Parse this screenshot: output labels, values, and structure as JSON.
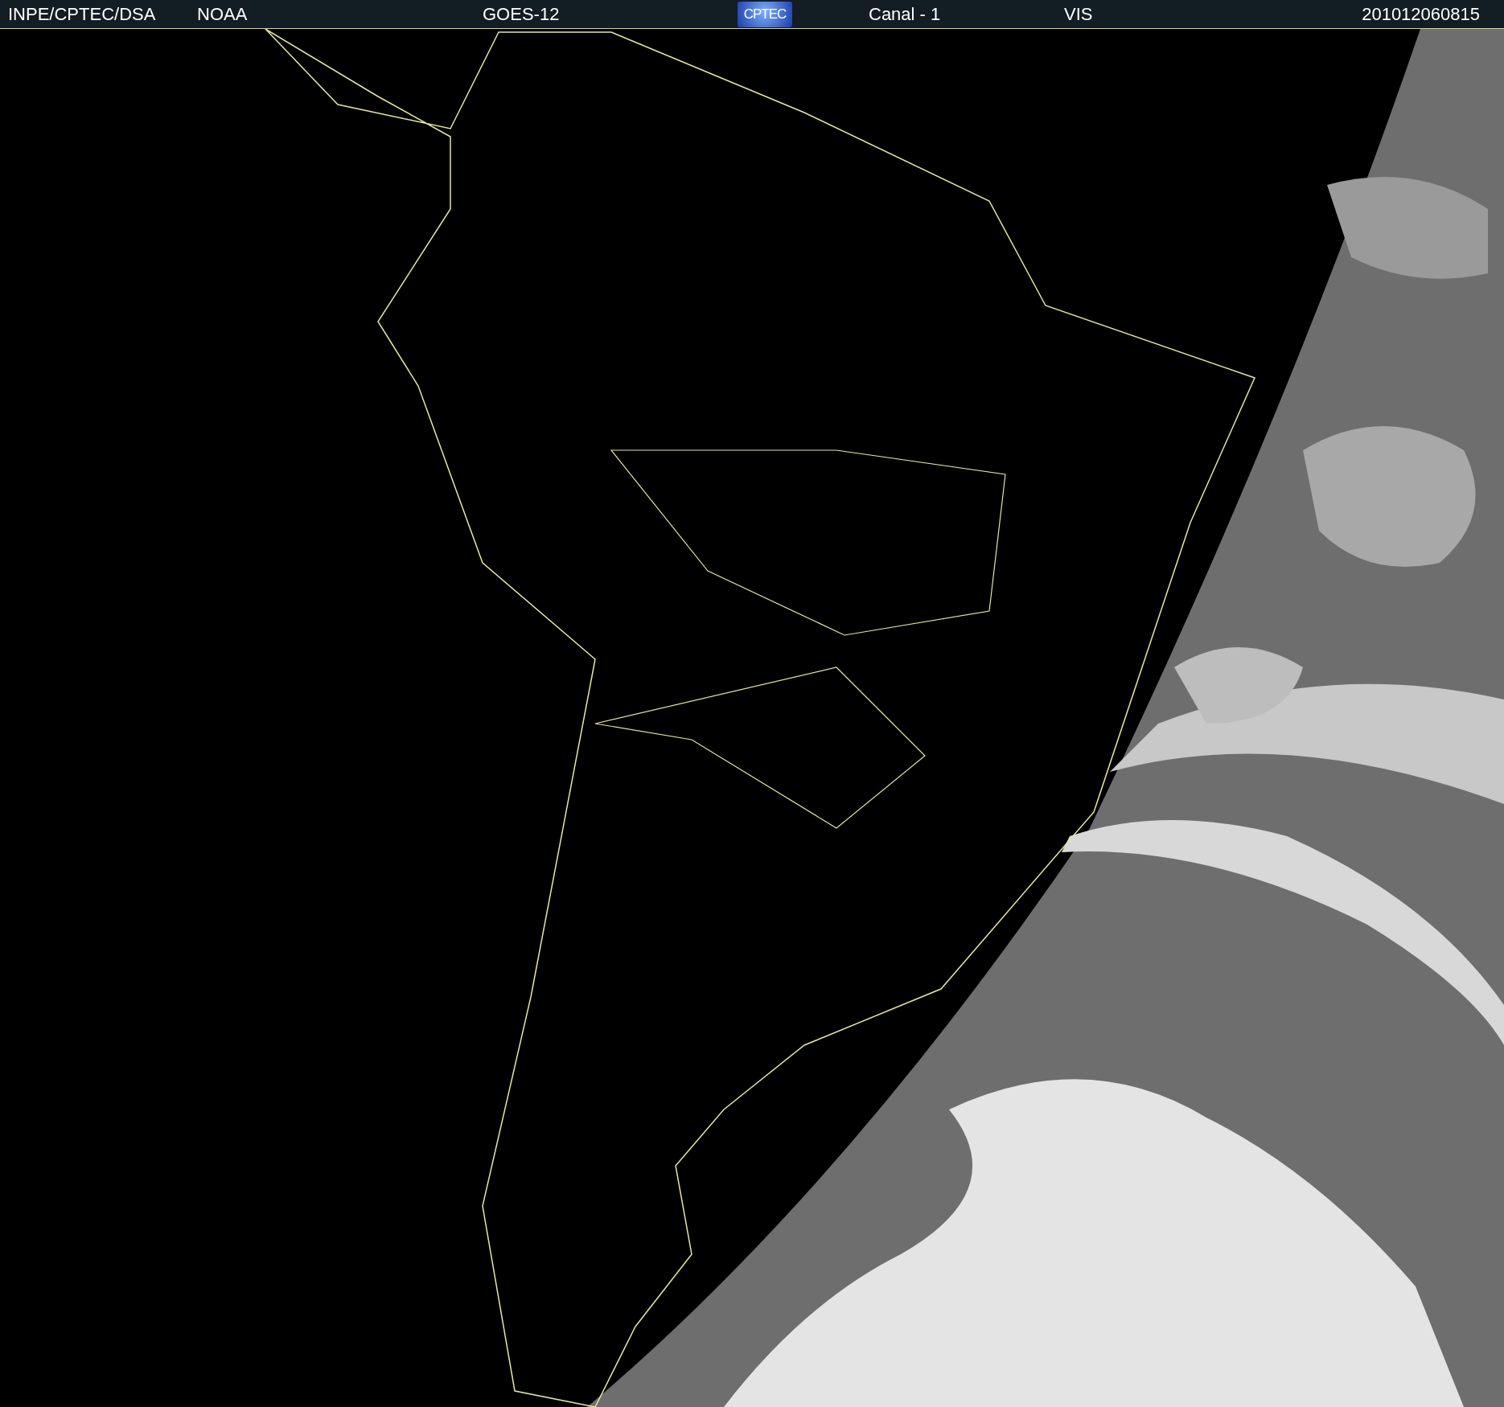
{
  "header": {
    "source": "INPE/CPTEC/DSA",
    "agency": "NOAA",
    "satellite": "GOES-12",
    "logo": "CPTEC",
    "channel": "Canal - 1",
    "band": "VIS",
    "timestamp": "201012060815"
  }
}
